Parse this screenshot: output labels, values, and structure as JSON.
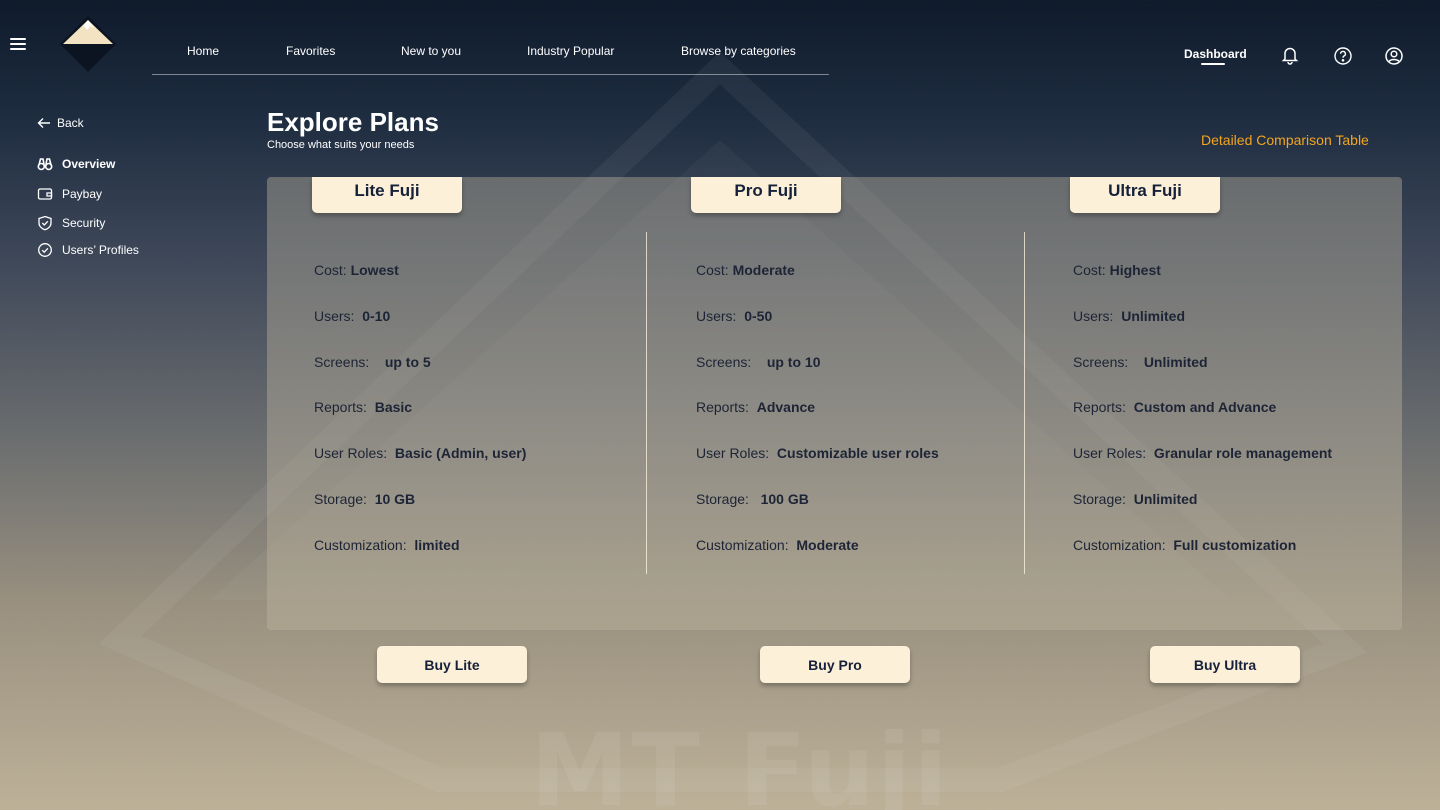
{
  "brand": {
    "logo_text": "MT Fuji",
    "watermark": "MT Fuji"
  },
  "nav": [
    "Home",
    "Favorites",
    "New to you",
    "Industry Popular",
    "Browse by categories"
  ],
  "header": {
    "dashboard_label": "Dashboard",
    "icons": [
      "hamburger-menu-icon",
      "bell-icon",
      "help-icon",
      "user-account-icon"
    ]
  },
  "sidebar": {
    "back_label": "Back",
    "items": [
      {
        "label": "Overview",
        "icon": "binoculars-icon",
        "active": true
      },
      {
        "label": "Paybay",
        "icon": "wallet-icon",
        "active": false
      },
      {
        "label": "Security",
        "icon": "shield-icon",
        "active": false
      },
      {
        "label": "Users’ Profiles",
        "icon": "check-circle-icon",
        "active": false
      }
    ]
  },
  "page": {
    "title": "Explore Plans",
    "subtitle": "Choose what suits your needs",
    "compare_link": "Detailed Comparison Table"
  },
  "plans": [
    {
      "name": "Lite Fuji",
      "buy_label": "Buy Lite",
      "features": [
        {
          "label": "Cost: ",
          "value": "Lowest"
        },
        {
          "label": "Users:  ",
          "value": "0-10"
        },
        {
          "label": "Screens:    ",
          "value": "up to 5"
        },
        {
          "label": "Reports:  ",
          "value": "Basic"
        },
        {
          "label": "User Roles:  ",
          "value": "Basic (Admin, user)"
        },
        {
          "label": "Storage:  ",
          "value": "10 GB"
        },
        {
          "label": "Customization:  ",
          "value": "limited"
        }
      ]
    },
    {
      "name": "Pro Fuji",
      "buy_label": "Buy Pro",
      "features": [
        {
          "label": "Cost: ",
          "value": "Moderate"
        },
        {
          "label": "Users:  ",
          "value": "0-50"
        },
        {
          "label": "Screens:    ",
          "value": "up to 10"
        },
        {
          "label": "Reports:  ",
          "value": "Advance"
        },
        {
          "label": "User Roles:  ",
          "value": "Customizable user roles"
        },
        {
          "label": "Storage:   ",
          "value": "100 GB"
        },
        {
          "label": "Customization:  ",
          "value": "Moderate"
        }
      ]
    },
    {
      "name": "Ultra Fuji",
      "buy_label": "Buy Ultra",
      "features": [
        {
          "label": "Cost: ",
          "value": "Highest"
        },
        {
          "label": "Users:  ",
          "value": "Unlimited"
        },
        {
          "label": "Screens:    ",
          "value": "Unlimited"
        },
        {
          "label": "Reports:  ",
          "value": "Custom and Advance"
        },
        {
          "label": "User Roles:  ",
          "value": "Granular role management"
        },
        {
          "label": "Storage:  ",
          "value": "Unlimited"
        },
        {
          "label": "Customization:  ",
          "value": "Full customization"
        }
      ]
    }
  ],
  "colors": {
    "accent": "#f2a51f",
    "card": "#fdf0d8",
    "text_dark": "#1d2435"
  }
}
